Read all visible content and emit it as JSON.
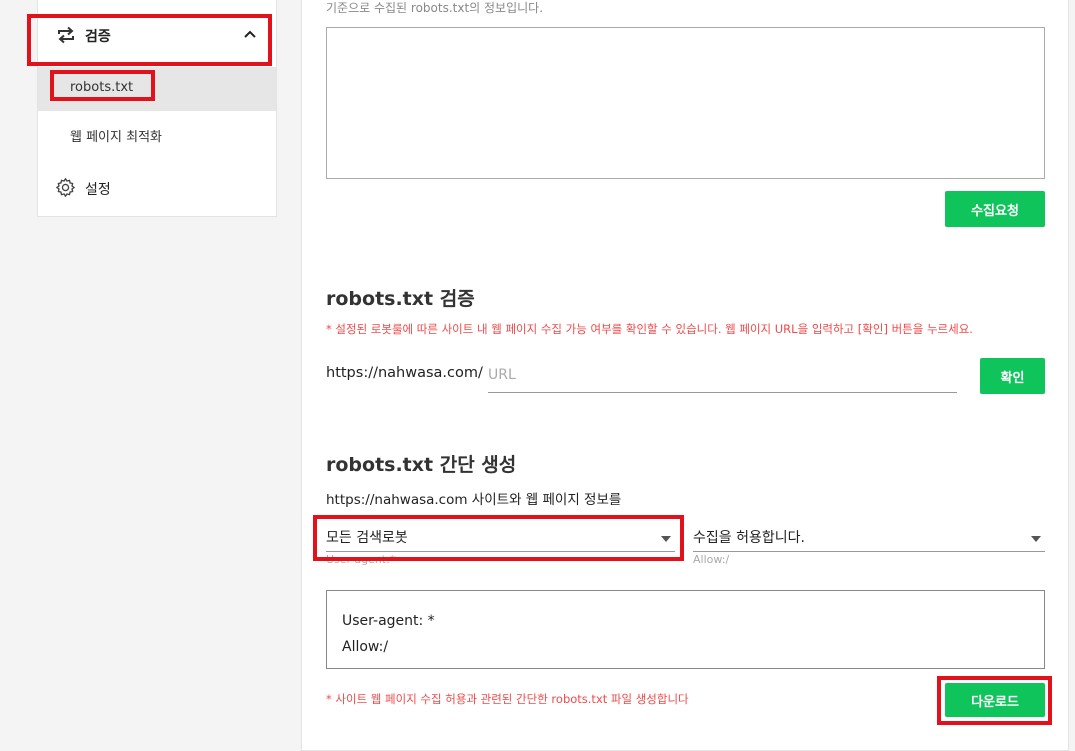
{
  "sidebar": {
    "group_label": "검증",
    "items": [
      {
        "label": "robots.txt",
        "active": true
      },
      {
        "label": "웹 페이지 최적화",
        "active": false
      }
    ],
    "settings_label": "설정"
  },
  "collect": {
    "caption": "기준으로 수집된 robots.txt의 정보입니다.",
    "button_label": "수집요청"
  },
  "verify": {
    "title": "robots.txt 검증",
    "note": "* 설정된 로봇룰에 따른 사이트 내 웹 페이지 수집 가능 여부를 확인할 수 있습니다. 웹 페이지 URL을 입력하고 [확인] 버튼을 누르세요.",
    "url_prefix": "https://nahwasa.com/",
    "url_placeholder": "URL",
    "url_value": "",
    "button_label": "확인"
  },
  "generate": {
    "title": "robots.txt 간단 생성",
    "description": "https://nahwasa.com 사이트와 웹 페이지 정보를",
    "agent_select": {
      "value": "모든 검색로봇",
      "helper": "User-agent:*"
    },
    "allow_select": {
      "value": "수집을 허용합니다.",
      "helper": "Allow:/"
    },
    "preview_lines": [
      "User-agent: *",
      "Allow:/"
    ],
    "note": "* 사이트 웹 페이지 수집 허용과 관련된 간단한 robots.txt 파일 생성합니다",
    "button_label": "다운로드"
  },
  "colors": {
    "accent_green": "#10c45c",
    "warning_red": "#f04a4a",
    "highlight_red": "#e1121c"
  }
}
